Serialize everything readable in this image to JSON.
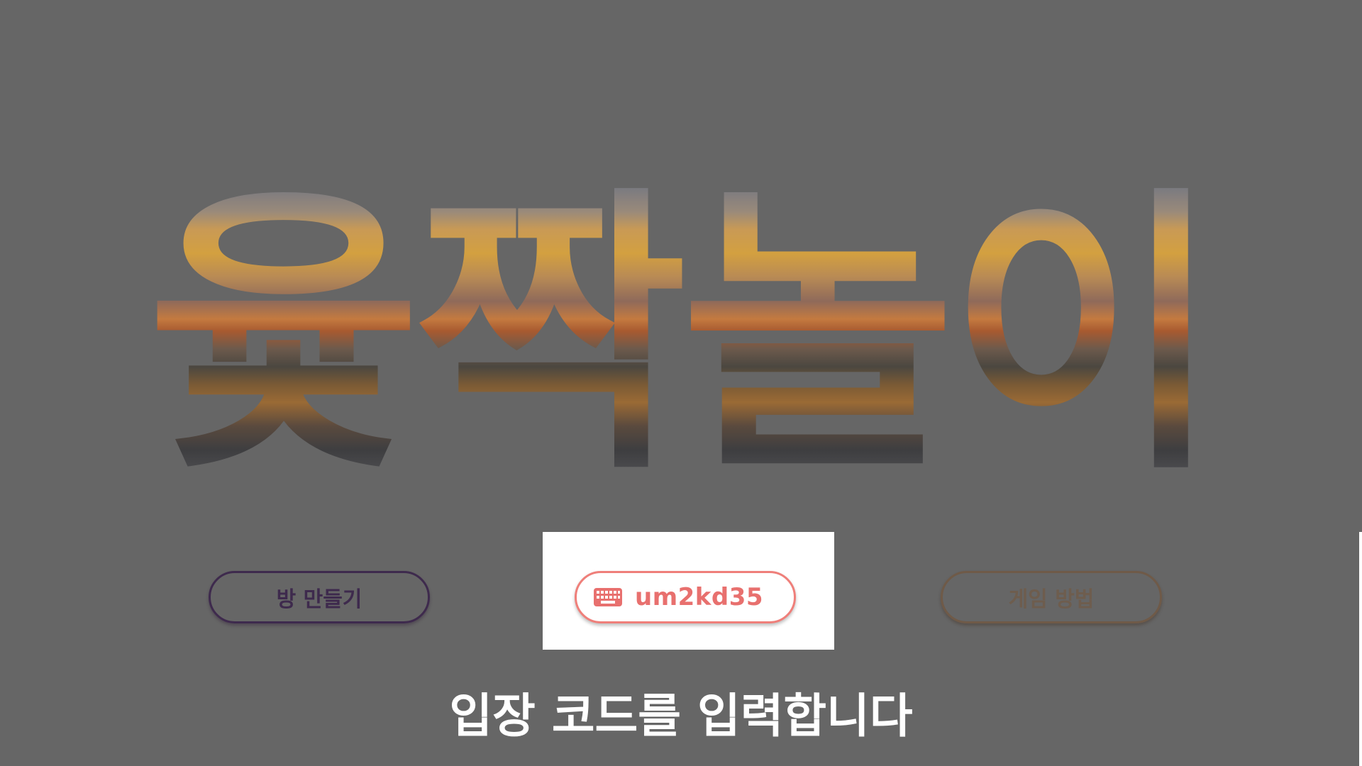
{
  "title": "윷짝놀이",
  "buttons": {
    "create_room": "방 만들기",
    "how_to_play": "게임 방법"
  },
  "code_field": {
    "icon": "keyboard-icon",
    "value": "um2kd35"
  },
  "instruction": "입장 코드를 입력합니다",
  "colors": {
    "background": "#666666",
    "create_button": "#3e2a4d",
    "how_to_button": "#6f5a48",
    "code_accent": "#e8706e",
    "highlight": "#ffffff"
  }
}
